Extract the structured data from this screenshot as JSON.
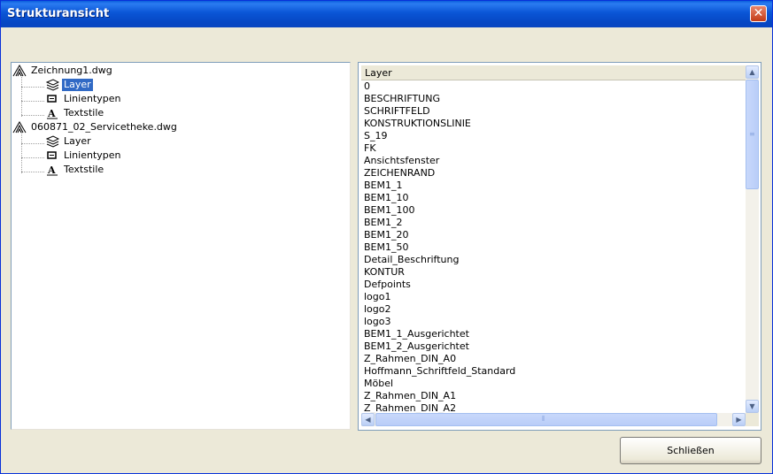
{
  "window": {
    "title": "Strukturansicht",
    "close_glyph": "✕"
  },
  "tree": {
    "drawings": [
      {
        "name": "Zeichnung1.dwg",
        "children": [
          {
            "label": "Layer",
            "icon": "layer-icon",
            "selected": true
          },
          {
            "label": "Linientypen",
            "icon": "linetype-icon",
            "selected": false
          },
          {
            "label": "Textstile",
            "icon": "textstyle-icon",
            "selected": false
          }
        ]
      },
      {
        "name": "060871_02_Servicetheke.dwg",
        "children": [
          {
            "label": "Layer",
            "icon": "layer-icon",
            "selected": false
          },
          {
            "label": "Linientypen",
            "icon": "linetype-icon",
            "selected": false
          },
          {
            "label": "Textstile",
            "icon": "textstyle-icon",
            "selected": false
          }
        ]
      }
    ]
  },
  "list": {
    "header": "Layer",
    "rows": [
      "0",
      "BESCHRIFTUNG",
      "SCHRIFTFELD",
      "KONSTRUKTIONSLINIE",
      "S_19",
      "FK",
      "Ansichtsfenster",
      "ZEICHENRAND",
      "BEM1_1",
      "BEM1_10",
      "BEM1_100",
      "BEM1_2",
      "BEM1_20",
      "BEM1_50",
      "Detail_Beschriftung",
      "KONTUR",
      "Defpoints",
      "logo1",
      "logo2",
      "logo3",
      "BEM1_1_Ausgerichtet",
      "BEM1_2_Ausgerichtet",
      "Z_Rahmen_DIN_A0",
      "Hoffmann_Schriftfeld_Standard",
      "Möbel",
      "Z_Rahmen_DIN_A1",
      "Z_Rahmen_DIN_A2"
    ]
  },
  "buttons": {
    "close_label": "Schließen"
  },
  "colors": {
    "selection": "#316ac5",
    "titlebar": "#0a55d6"
  }
}
